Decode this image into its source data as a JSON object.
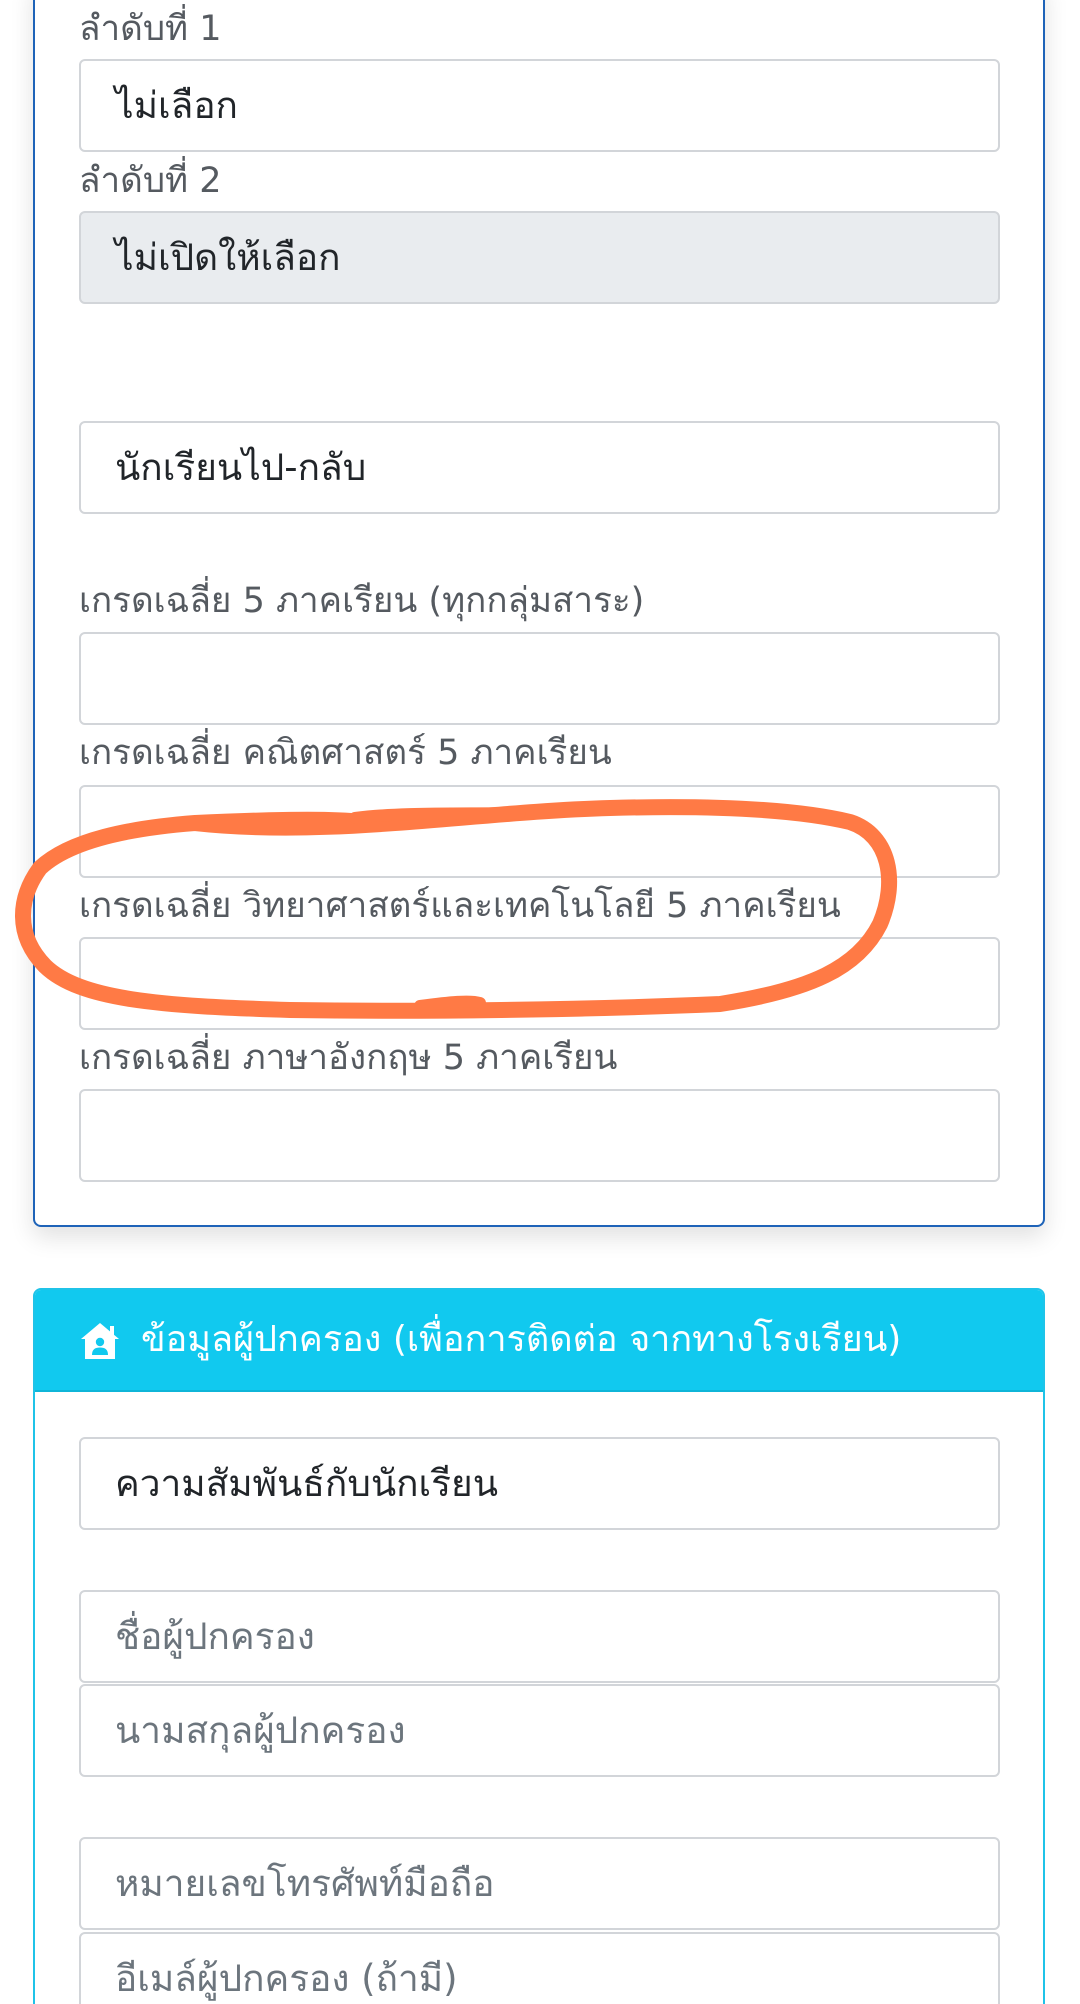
{
  "top_card": {
    "rank1_label": "ลำดับที่ 1",
    "rank1_value": "ไม่เลือก",
    "rank2_label": "ลำดับที่ 2",
    "rank2_value": "ไม่เปิดให้เลือก",
    "transport_value": "นักเรียนไป-กลับ",
    "gpa_all_label": "เกรดเฉลี่ย 5 ภาคเรียน (ทุกกลุ่มสาระ)",
    "gpa_all_value": "",
    "gpa_math_label": "เกรดเฉลี่ย คณิตศาสตร์ 5 ภาคเรียน",
    "gpa_math_value": "",
    "gpa_sci_label": "เกรดเฉลี่ย วิทยาศาสตร์และเทคโนโลยี 5 ภาคเรียน",
    "gpa_sci_value": "",
    "gpa_eng_label": "เกรดเฉลี่ย ภาษาอังกฤษ 5 ภาคเรียน",
    "gpa_eng_value": ""
  },
  "guardian_card": {
    "header_icon": "house-user-icon",
    "header_title": "ข้อมูลผู้ปกครอง (เพื่อการติดต่อ จากทางโรงเรียน)",
    "relationship_value": "ความสัมพันธ์กับนักเรียน",
    "firstname_placeholder": "ชื่อผู้ปกครอง",
    "lastname_placeholder": "นามสกุลผู้ปกครอง",
    "phone_placeholder": "หมายเลขโทรศัพท์มือถือ",
    "email_placeholder": "อีเมล์ผู้ปกครอง (ถ้ามี)"
  },
  "colors": {
    "card_border": "#1e63b8",
    "header_bg": "#11c9ef",
    "annotation": "#ff7a45"
  }
}
